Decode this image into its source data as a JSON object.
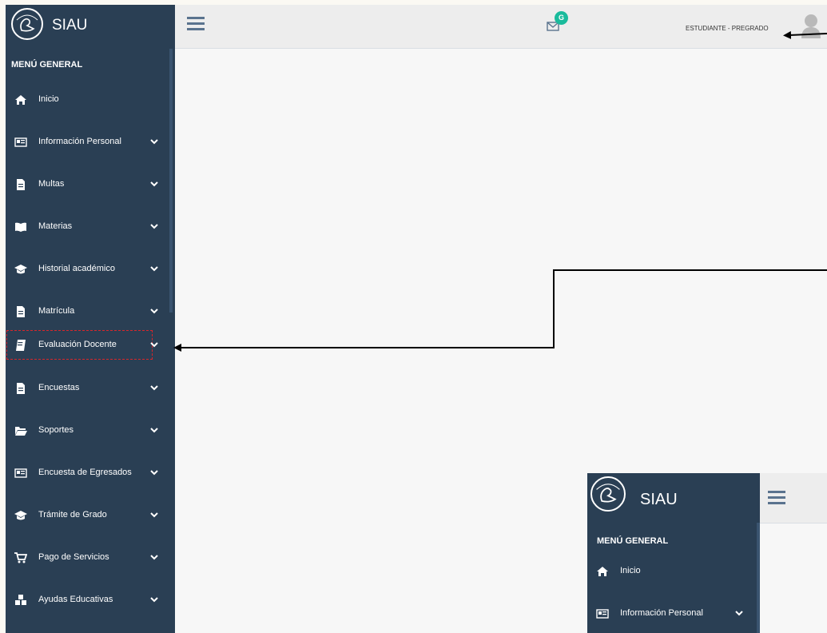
{
  "app": {
    "name": "SIAU"
  },
  "sidebar": {
    "heading": "MENÚ GENERAL",
    "items": [
      {
        "label": "Inicio",
        "icon": "home-icon",
        "has_submenu": false
      },
      {
        "label": "Información Personal",
        "icon": "id-card-icon",
        "has_submenu": true
      },
      {
        "label": "Multas",
        "icon": "document-icon",
        "has_submenu": true
      },
      {
        "label": "Materias",
        "icon": "book-icon",
        "has_submenu": true
      },
      {
        "label": "Historial académico",
        "icon": "graduation-cap-icon",
        "has_submenu": true
      },
      {
        "label": "Matrícula",
        "icon": "document-icon",
        "has_submenu": true
      },
      {
        "label": "Evaluación Docente",
        "icon": "book-edit-icon",
        "has_submenu": true,
        "highlighted": true
      },
      {
        "label": "Encuestas",
        "icon": "document-icon",
        "has_submenu": true
      },
      {
        "label": "Soportes",
        "icon": "folder-icon",
        "has_submenu": true
      },
      {
        "label": "Encuesta de Egresados",
        "icon": "id-card-icon",
        "has_submenu": true
      },
      {
        "label": "Trámite de Grado",
        "icon": "graduation-cap-icon",
        "has_submenu": true
      },
      {
        "label": "Pago de Servicios",
        "icon": "cart-icon",
        "has_submenu": true
      },
      {
        "label": "Ayudas Educativas",
        "icon": "cubes-icon",
        "has_submenu": true
      }
    ]
  },
  "topbar": {
    "notification_badge": "G",
    "user_role": "ESTUDIANTE - PREGRADO"
  },
  "inset": {
    "app_name": "SIAU",
    "heading": "MENÚ GENERAL",
    "items": [
      {
        "label": "Inicio"
      },
      {
        "label": "Información Personal"
      }
    ]
  },
  "colors": {
    "sidebar_bg": "#2a3f54",
    "topbar_bg": "#ededed",
    "content_bg": "#f7f7f7",
    "badge": "#1abb9c",
    "highlight_border": "#d9262b"
  }
}
